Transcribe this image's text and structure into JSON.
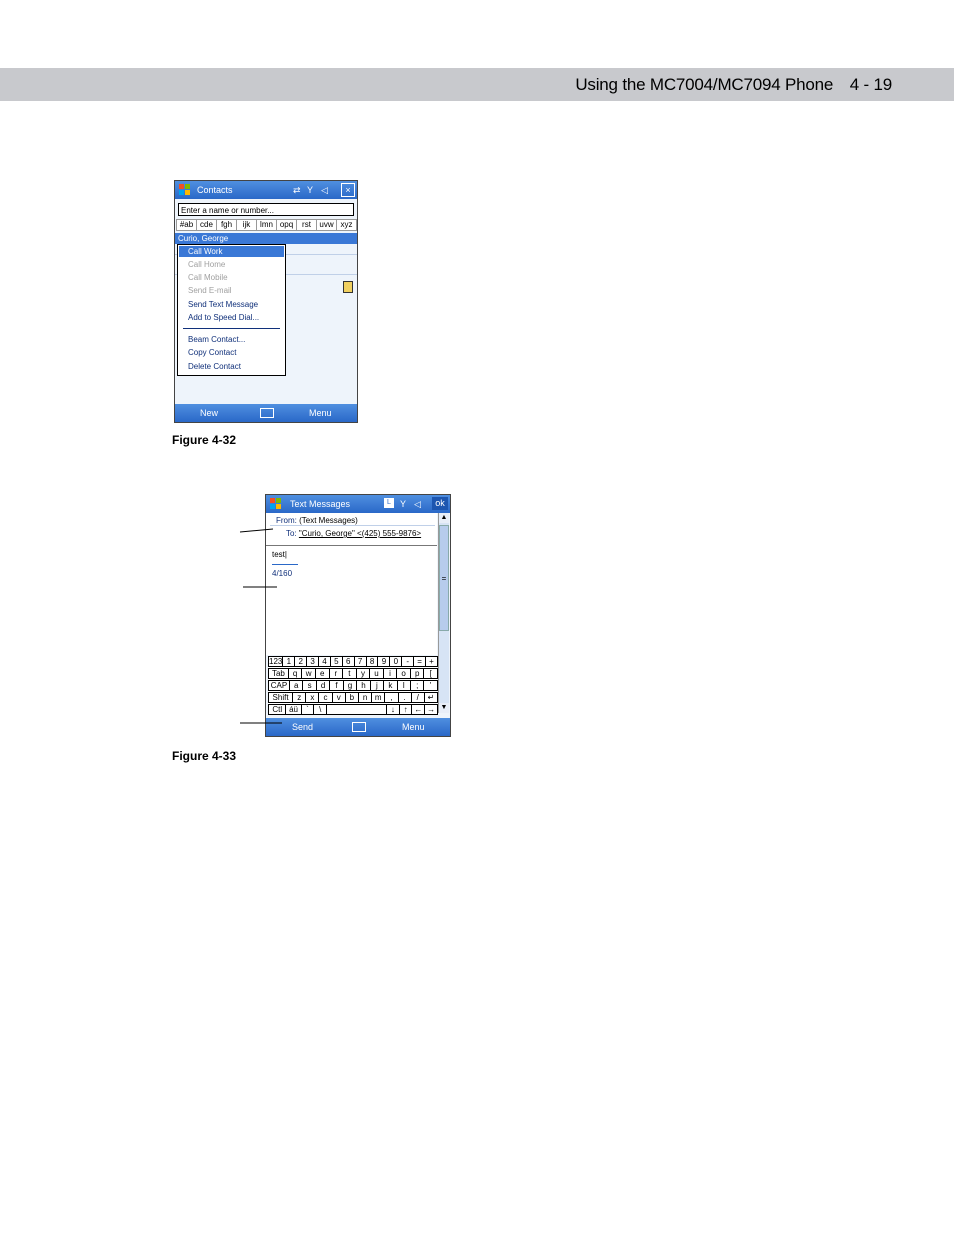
{
  "header": {
    "title": "Using the MC7004/MC7094 Phone",
    "page": "4 - 19"
  },
  "fig1": {
    "caption": "Figure 4-32",
    "title": "Contacts",
    "search_placeholder": "Enter a name or number...",
    "alpha_tabs": [
      "#ab",
      "cde",
      "fgh",
      "ijk",
      "lmn",
      "opq",
      "rst",
      "uvw",
      "xyz"
    ],
    "selected_contact": "Curio, George",
    "menu_items": [
      "Call Work",
      "Call Home",
      "Call Mobile",
      "Send E-mail",
      "Send Text Message",
      "Add to Speed Dial...",
      "Beam Contact...",
      "Copy Contact",
      "Delete Contact"
    ],
    "softkey_left": "New",
    "softkey_right": "Menu"
  },
  "fig2": {
    "caption": "Figure 4-33",
    "title": "Text Messages",
    "ok_label": "ok",
    "from_label": "From:",
    "from_value": "(Text Messages)",
    "to_label": "To:",
    "to_value": "\"Curio, George\" <(425) 555-9876>",
    "body_text": "test",
    "char_count": "4/160",
    "keyboard_rows": [
      [
        "123",
        "1",
        "2",
        "3",
        "4",
        "5",
        "6",
        "7",
        "8",
        "9",
        "0",
        "-",
        "=",
        "+"
      ],
      [
        "Tab",
        "q",
        "w",
        "e",
        "r",
        "t",
        "y",
        "u",
        "i",
        "o",
        "p",
        "["
      ],
      [
        "CAP",
        "a",
        "s",
        "d",
        "f",
        "g",
        "h",
        "j",
        "k",
        "l",
        ";",
        "'"
      ],
      [
        "Shift",
        "z",
        "x",
        "c",
        "v",
        "b",
        "n",
        "m",
        ",",
        ".",
        "/",
        "↵"
      ],
      [
        "Ctl",
        "áü",
        "`",
        "\\",
        "",
        "↓",
        "↑",
        "←",
        "→"
      ]
    ],
    "softkey_left": "Send",
    "softkey_right": "Menu"
  }
}
